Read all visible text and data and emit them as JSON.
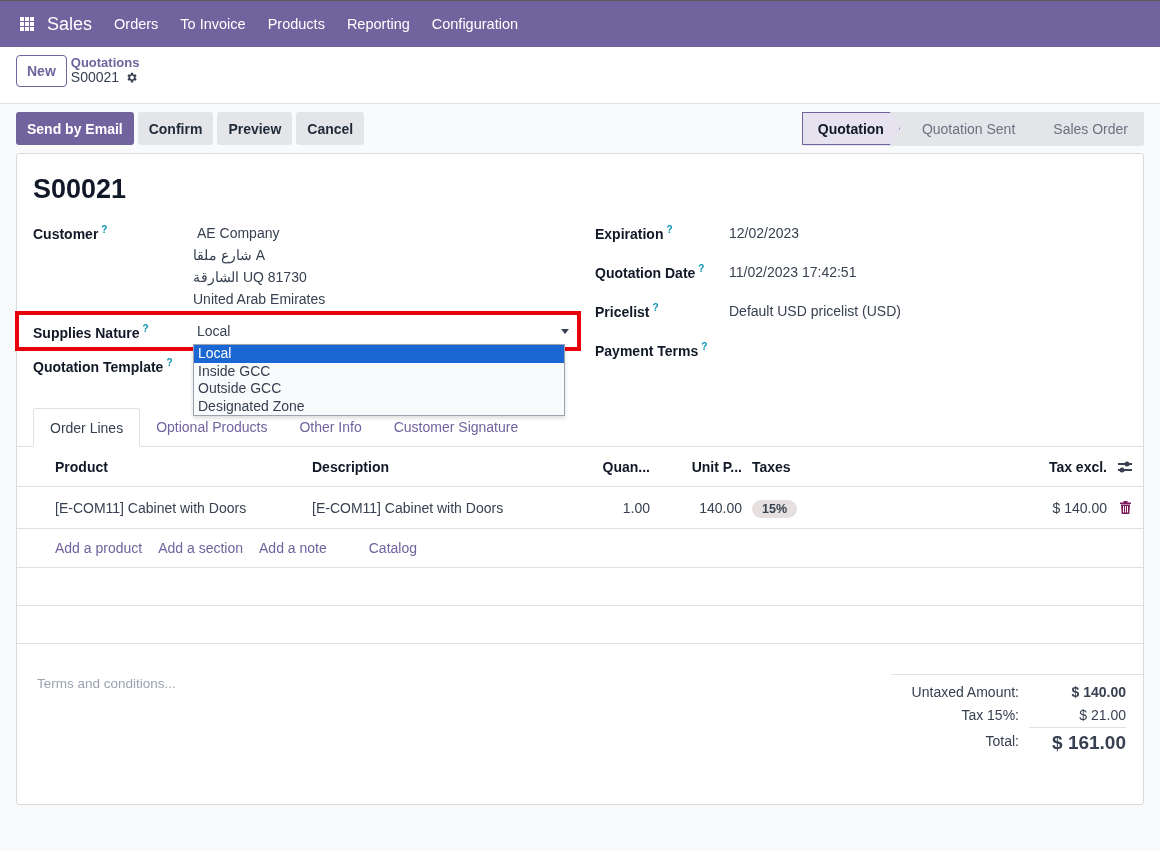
{
  "navbar": {
    "app": "Sales",
    "menu": [
      "Orders",
      "To Invoice",
      "Products",
      "Reporting",
      "Configuration"
    ]
  },
  "control_panel": {
    "new_button": "New",
    "breadcrumb_parent": "Quotations",
    "breadcrumb_current": "S00021"
  },
  "action_buttons": [
    {
      "label": "Send by Email",
      "kind": "primary"
    },
    {
      "label": "Confirm",
      "kind": "secondary"
    },
    {
      "label": "Preview",
      "kind": "secondary"
    },
    {
      "label": "Cancel",
      "kind": "secondary"
    }
  ],
  "stages": [
    {
      "label": "Quotation",
      "selected": true
    },
    {
      "label": "Quotation Sent",
      "selected": false
    },
    {
      "label": "Sales Order",
      "selected": false
    }
  ],
  "record_title": "S00021",
  "left_fields": [
    {
      "label": "Customer",
      "help": "?",
      "kind": "address",
      "lines": [
        "AE Company",
        "شارع ملقا A",
        "الشارقة UQ 81730",
        "United Arab Emirates"
      ],
      "highlighted": false
    },
    {
      "label": "Supplies Nature",
      "help": "?",
      "kind": "select",
      "value": "Local",
      "highlighted": true,
      "options": [
        {
          "label": "Local",
          "selected": true
        },
        {
          "label": "Inside GCC",
          "selected": false
        },
        {
          "label": "Outside GCC",
          "selected": false
        },
        {
          "label": "Designated Zone",
          "selected": false
        }
      ]
    },
    {
      "label": "Quotation Template",
      "help": "?",
      "kind": "text",
      "highlighted": false
    }
  ],
  "right_fields": [
    {
      "label": "Expiration",
      "help": "?",
      "value": "12/02/2023"
    },
    {
      "label": "Quotation Date",
      "help": "?",
      "value": "11/02/2023 17:42:51"
    },
    {
      "label": "Pricelist",
      "help": "?",
      "value": "Default USD pricelist (USD)"
    },
    {
      "label": "Payment Terms",
      "help": "?"
    }
  ],
  "tabs": [
    {
      "label": "Order Lines",
      "selected": true
    },
    {
      "label": "Optional Products",
      "selected": false
    },
    {
      "label": "Other Info",
      "selected": false
    },
    {
      "label": "Customer Signature",
      "selected": false
    }
  ],
  "table": {
    "columns": [
      "Product",
      "Description",
      "Quan...",
      "Unit P...",
      "Taxes",
      "Tax excl."
    ],
    "rows": [
      {
        "product": "[E-COM11] Cabinet with Doors",
        "description": "[E-COM11] Cabinet with Doors",
        "quantity": "1.00",
        "unit_price": "140.00",
        "taxes": "15%",
        "tax_excl": "$ 140.00"
      }
    ],
    "add_links": [
      "Add a product",
      "Add a section",
      "Add a note",
      "Catalog"
    ]
  },
  "terms": {
    "placeholder": "Terms and conditions..."
  },
  "totals": [
    {
      "label": "Untaxed Amount:",
      "value": "$ 140.00",
      "kind": "subtotal"
    },
    {
      "label": "Tax 15%:",
      "value": "$ 21.00",
      "kind": "tax"
    },
    {
      "label": "Total:",
      "value": "$ 161.00",
      "kind": "total"
    }
  ]
}
